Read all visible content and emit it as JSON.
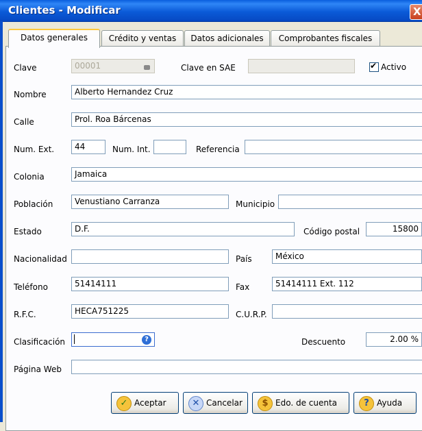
{
  "window": {
    "title": "Clientes - Modificar",
    "close": "X"
  },
  "tabs": [
    {
      "label": "Datos generales",
      "active": true
    },
    {
      "label": "Crédito y ventas",
      "active": false
    },
    {
      "label": "Datos adicionales",
      "active": false
    },
    {
      "label": "Comprobantes fiscales",
      "active": false
    }
  ],
  "form": {
    "clave": {
      "label": "Clave",
      "value": "00001"
    },
    "clave_sae": {
      "label": "Clave en SAE",
      "value": ""
    },
    "activo": {
      "label": "Activo",
      "checked": true
    },
    "nombre": {
      "label": "Nombre",
      "value": "Alberto Hernandez Cruz"
    },
    "calle": {
      "label": "Calle",
      "value": "Prol. Roa Bárcenas"
    },
    "num_ext": {
      "label": "Num. Ext.",
      "value": "44"
    },
    "num_int": {
      "label": "Num. Int.",
      "value": ""
    },
    "referencia": {
      "label": "Referencia",
      "value": ""
    },
    "colonia": {
      "label": "Colonia",
      "value": "Jamaica"
    },
    "poblacion": {
      "label": "Población",
      "value": "Venustiano Carranza"
    },
    "municipio": {
      "label": "Municipio",
      "value": ""
    },
    "estado": {
      "label": "Estado",
      "value": "D.F."
    },
    "codigo_postal": {
      "label": "Código postal",
      "value": "15800"
    },
    "nacionalidad": {
      "label": "Nacionalidad",
      "value": ""
    },
    "pais": {
      "label": "País",
      "value": "México"
    },
    "telefono": {
      "label": "Teléfono",
      "value": "51414111"
    },
    "fax": {
      "label": "Fax",
      "value": "51414111 Ext. 112"
    },
    "rfc": {
      "label": "R.F.C.",
      "value": "HECA751225"
    },
    "curp": {
      "label": "C.U.R.P.",
      "value": ""
    },
    "clasificacion": {
      "label": "Clasificación",
      "value": ""
    },
    "descuento": {
      "label": "Descuento",
      "value": "2.00 %"
    },
    "pagina_web": {
      "label": "Página Web",
      "value": ""
    }
  },
  "buttons": {
    "aceptar": "Aceptar",
    "cancelar": "Cancelar",
    "edo_cuenta": "Edo. de cuenta",
    "ayuda": "Ayuda"
  },
  "colors": {
    "titlebar": "#0a5ede",
    "window_bg": "#ece9d8",
    "panel_bg": "#fcfcfe",
    "field_border": "#7f9db9"
  }
}
